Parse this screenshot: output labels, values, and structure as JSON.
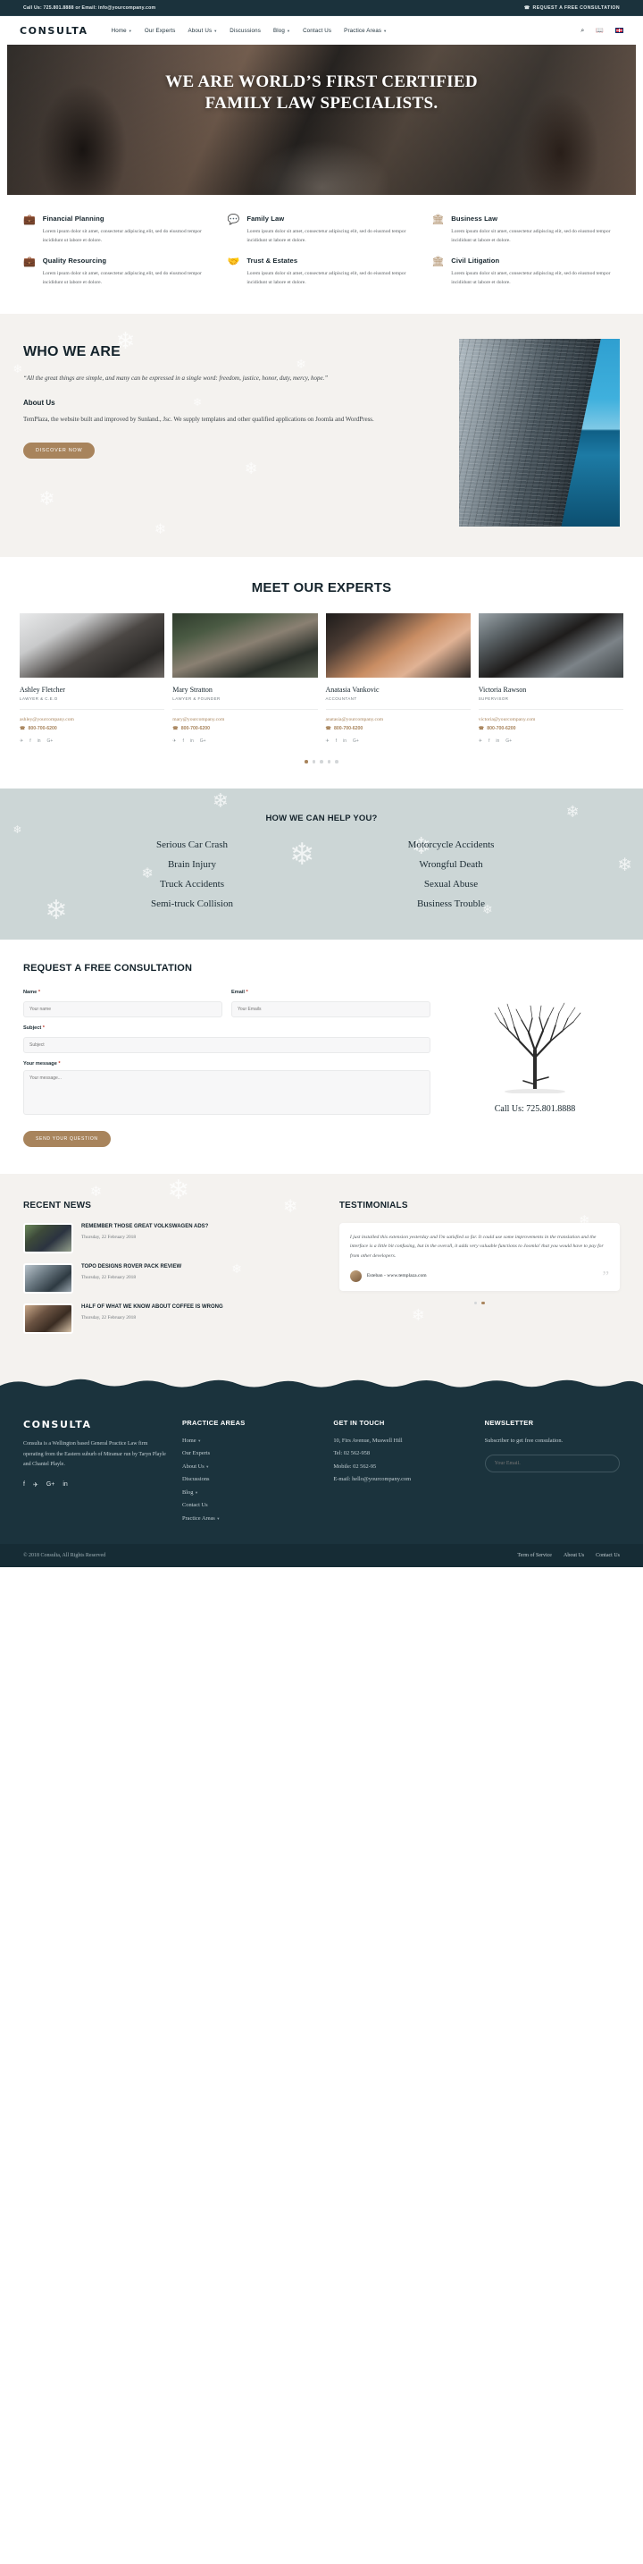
{
  "topbar": {
    "contact": "Call Us: 725.801.8888 or Email: info@yourcompany.com",
    "cta": "REQUEST A FREE CONSULTATION",
    "cta_icon": "phone-icon"
  },
  "nav": {
    "logo": "CONSULTA",
    "items": [
      {
        "label": "Home",
        "has_caret": true
      },
      {
        "label": "Our Experts",
        "has_caret": false
      },
      {
        "label": "About Us",
        "has_caret": true
      },
      {
        "label": "Discussions",
        "has_caret": false
      },
      {
        "label": "Blog",
        "has_caret": true
      },
      {
        "label": "Contact Us",
        "has_caret": false
      },
      {
        "label": "Practice Areas",
        "has_caret": true
      }
    ],
    "icons": [
      "search-icon",
      "book-icon",
      "flag-uk-icon"
    ]
  },
  "hero": {
    "line1": "WE ARE WORLD’S FIRST CERTIFIED",
    "line2": "FAMILY LAW SPECIALISTS."
  },
  "services": [
    {
      "icon": "briefcase-icon",
      "title": "Financial Planning",
      "text": "Lorem ipsum dolor sit amet, consectetur adipiscing elit, sed do eiusmod tempor incididunt ut labore et dolore."
    },
    {
      "icon": "chat-bubbles-icon",
      "title": "Family Law",
      "text": "Lorem ipsum dolor sit amet, consectetur adipiscing elit, sed do eiusmod tempor incididunt ut labore et dolore."
    },
    {
      "icon": "bank-icon",
      "title": "Business Law",
      "text": "Lorem ipsum dolor sit amet, consectetur adipiscing elit, sed do eiusmod tempor incididunt ut labore et dolore."
    },
    {
      "icon": "briefcase-icon",
      "title": "Quality Resourcing",
      "text": "Lorem ipsum dolor sit amet, consectetur adipiscing elit, sed do eiusmod tempor incididunt ut labore et dolore."
    },
    {
      "icon": "handshake-icon",
      "title": "Trust & Estates",
      "text": "Lorem ipsum dolor sit amet, consectetur adipiscing elit, sed do eiusmod tempor incididunt ut labore et dolore."
    },
    {
      "icon": "pillar-icon",
      "title": "Civil Litigation",
      "text": "Lorem ipsum dolor sit amet, consectetur adipiscing elit, sed do eiusmod tempor incididunt ut labore et dolore."
    }
  ],
  "who": {
    "heading": "WHO WE ARE",
    "quote": "“All the great things are simple, and many can be expressed in a single word: freedom, justice, honor, duty, mercy, hope.”",
    "subheading": "About Us",
    "body": "TemPlaza, the website built and improved by Sunland., Jsc. We supply templates and other qualified applications on Joomla and WordPress.",
    "button": "DISCOVER NOW"
  },
  "experts": {
    "heading": "MEET OUR EXPERTS",
    "people": [
      {
        "name": "Ashley Fletcher",
        "role": "LAWYER & C.E.O",
        "email": "ashley@yourcompany.com",
        "phone": "800-700-6200",
        "photo": "p1"
      },
      {
        "name": "Mary Stratton",
        "role": "LAWYER & FOUNDER",
        "email": "mary@yourcompany.com",
        "phone": "800-700-6200",
        "photo": "p2"
      },
      {
        "name": "Anatasia Vankovic",
        "role": "ACCOUNTANT",
        "email": "anatasia@yourcompany.com",
        "phone": "800-700-6200",
        "photo": "p3"
      },
      {
        "name": "Victoria Rawson",
        "role": "SUPERVISOR",
        "email": "victoria@yourcompany.com",
        "phone": "800-700-6200",
        "photo": "p4"
      }
    ],
    "socials": [
      "twitter-icon",
      "facebook-icon",
      "linkedin-icon",
      "google-plus-icon"
    ],
    "dots": 5,
    "active_dot": 0
  },
  "help": {
    "heading": "HOW WE CAN HELP YOU?",
    "items": [
      "Serious Car Crash",
      "Motorcycle Accidents",
      "Brain Injury",
      "Wrongful Death",
      "Truck Accidents",
      "Sexual Abuse",
      "Semi-truck Collision",
      "Business Trouble"
    ]
  },
  "consult": {
    "heading": "REQUEST A FREE CONSULTATION",
    "fields": {
      "name_label": "Name",
      "name_placeholder": "Your name",
      "email_label": "Email",
      "email_placeholder": "Your Emails",
      "subject_label": "Subject",
      "subject_placeholder": "Subject",
      "message_label": "Your message",
      "message_placeholder": "Your message..."
    },
    "required_mark": "*",
    "submit": "SEND YOUR QUESTION",
    "call_us": "Call Us: 725.801.8888"
  },
  "news": {
    "heading": "RECENT NEWS",
    "items": [
      {
        "title": "REMEMBER THOSE GREAT VOLKSWAGEN ADS?",
        "date": "Thursday, 22 February 2018",
        "thumb": "n1"
      },
      {
        "title": "TOPO DESIGNS ROVER PACK REVIEW",
        "date": "Thursday, 22 February 2018",
        "thumb": "n2"
      },
      {
        "title": "HALF OF WHAT WE KNOW ABOUT COFFEE IS WRONG",
        "date": "Thursday, 22 February 2018",
        "thumb": "n3"
      }
    ]
  },
  "testimonials": {
    "heading": "TESTIMONIALS",
    "quote": "I just installed this extension yesterday and I'm satisfied so far. It could use some improvements in the translation and the interface is a little bit confusing, but in the overall, it adds very valuable functions to Joomla! that you would have to pay for from other developers.",
    "author": "Esteban - www.templaza.com",
    "quote_mark": "”",
    "dots": 2,
    "active_dot": 1
  },
  "footer": {
    "logo": "CONSULTA",
    "description": "Consulta is a Wellington based General Practice Law firm operating from the Eastern suburb of Miramar run by Taryn Playle and Chantel Playle.",
    "socials": [
      "facebook-icon",
      "twitter-icon",
      "google-plus-icon",
      "linkedin-icon"
    ],
    "practice_areas": {
      "heading": "PRACTICE AREAS",
      "links": [
        {
          "label": "Home",
          "has_caret": true
        },
        {
          "label": "Our Experts",
          "has_caret": false
        },
        {
          "label": "About Us",
          "has_caret": true
        },
        {
          "label": "Discussions",
          "has_caret": false
        },
        {
          "label": "Blog",
          "has_caret": true
        },
        {
          "label": "Contact Us",
          "has_caret": false
        },
        {
          "label": "Practice Areas",
          "has_caret": true
        }
      ]
    },
    "get_in_touch": {
      "heading": "GET IN TOUCH",
      "address": "10, Firs Avenue, Muswell Hill",
      "tel": "Tel: 02 562-958",
      "mobile": "Mobile: 02 562-95",
      "email": "E-mail: hello@yourcompany.com"
    },
    "newsletter": {
      "heading": "NEWSLETTER",
      "text": "Subscriber to get free consulation.",
      "placeholder": "Your Email."
    },
    "copyright": "© 2018 Consulta, All Rights Reserved",
    "bottom_links": [
      "Term of Service",
      "About Us",
      "Contact Us"
    ]
  },
  "colors": {
    "dark": "#1b333d",
    "accent": "#a8845c",
    "help_bg": "#ccd6d6",
    "soft_bg": "#f4f2ef"
  }
}
